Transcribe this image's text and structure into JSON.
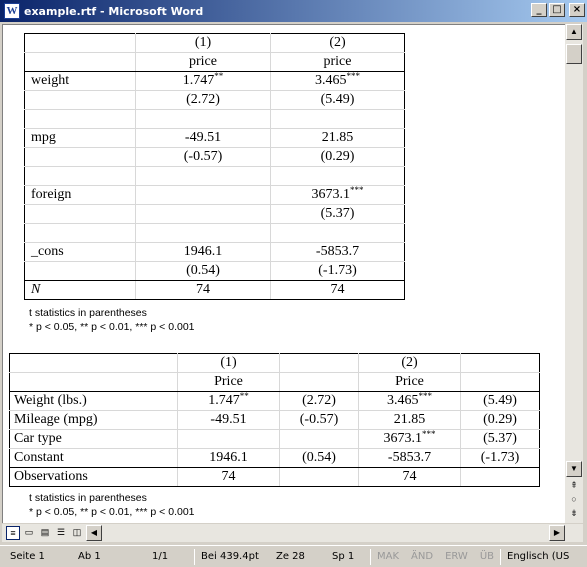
{
  "window": {
    "title": "example.rtf - Microsoft Word",
    "icon_glyph": "W",
    "minimize_glyph": "_",
    "maximize_glyph": "□",
    "close_glyph": "×"
  },
  "table1": {
    "header": {
      "col1": "(1)",
      "col2": "(2)"
    },
    "depvar": {
      "col1": "price",
      "col2": "price"
    },
    "rows": [
      {
        "label": "weight",
        "c1": "1.747",
        "c1_stars": "**",
        "c2": "3.465",
        "c2_stars": "***"
      },
      {
        "label": "",
        "c1": "(2.72)",
        "c1_stars": "",
        "c2": "(5.49)",
        "c2_stars": ""
      },
      {
        "label": "",
        "c1": "",
        "c1_stars": "",
        "c2": "",
        "c2_stars": ""
      },
      {
        "label": "mpg",
        "c1": "-49.51",
        "c1_stars": "",
        "c2": "21.85",
        "c2_stars": ""
      },
      {
        "label": "",
        "c1": "(-0.57)",
        "c1_stars": "",
        "c2": "(0.29)",
        "c2_stars": ""
      },
      {
        "label": "",
        "c1": "",
        "c1_stars": "",
        "c2": "",
        "c2_stars": ""
      },
      {
        "label": "foreign",
        "c1": "",
        "c1_stars": "",
        "c2": "3673.1",
        "c2_stars": "***"
      },
      {
        "label": "",
        "c1": "",
        "c1_stars": "",
        "c2": "(5.37)",
        "c2_stars": ""
      },
      {
        "label": "",
        "c1": "",
        "c1_stars": "",
        "c2": "",
        "c2_stars": ""
      },
      {
        "label": "_cons",
        "c1": "1946.1",
        "c1_stars": "",
        "c2": "-5853.7",
        "c2_stars": ""
      },
      {
        "label": "",
        "c1": "(0.54)",
        "c1_stars": "",
        "c2": "(-1.73)",
        "c2_stars": ""
      }
    ],
    "n_row": {
      "label": "N",
      "c1": "74",
      "c2": "74"
    },
    "note_line1": "t statistics in parentheses",
    "note_line2": "* p < 0.05, ** p < 0.01, *** p < 0.001"
  },
  "table2": {
    "header": {
      "col1": "(1)",
      "col3": "(2)"
    },
    "depvar": {
      "col1": "Price",
      "col3": "Price"
    },
    "rows": [
      {
        "label": "Weight (lbs.)",
        "c1": "1.747",
        "c1_stars": "**",
        "c2": "(2.72)",
        "c3": "3.465",
        "c3_stars": "***",
        "c4": "(5.49)"
      },
      {
        "label": "Mileage (mpg)",
        "c1": "-49.51",
        "c1_stars": "",
        "c2": "(-0.57)",
        "c3": "21.85",
        "c3_stars": "",
        "c4": "(0.29)"
      },
      {
        "label": "Car type",
        "c1": "",
        "c1_stars": "",
        "c2": "",
        "c3": "3673.1",
        "c3_stars": "***",
        "c4": "(5.37)"
      },
      {
        "label": "Constant",
        "c1": "1946.1",
        "c1_stars": "",
        "c2": "(0.54)",
        "c3": "-5853.7",
        "c3_stars": "",
        "c4": "(-1.73)"
      }
    ],
    "obs_row": {
      "label": "Observations",
      "c1": "74",
      "c3": "74"
    },
    "note_line1": "t statistics in parentheses",
    "note_line2": "* p < 0.05, ** p < 0.01, *** p < 0.001"
  },
  "statusbar": {
    "page": "Seite  1",
    "section": "Ab  1",
    "pages": "1/1",
    "position": "Bei  439.4pt",
    "line": "Ze  28",
    "column": "Sp  1",
    "rec": "MAK",
    "trk": "ÄND",
    "ext": "ERW",
    "ovr": "ÜB",
    "language": "Englisch (US"
  }
}
